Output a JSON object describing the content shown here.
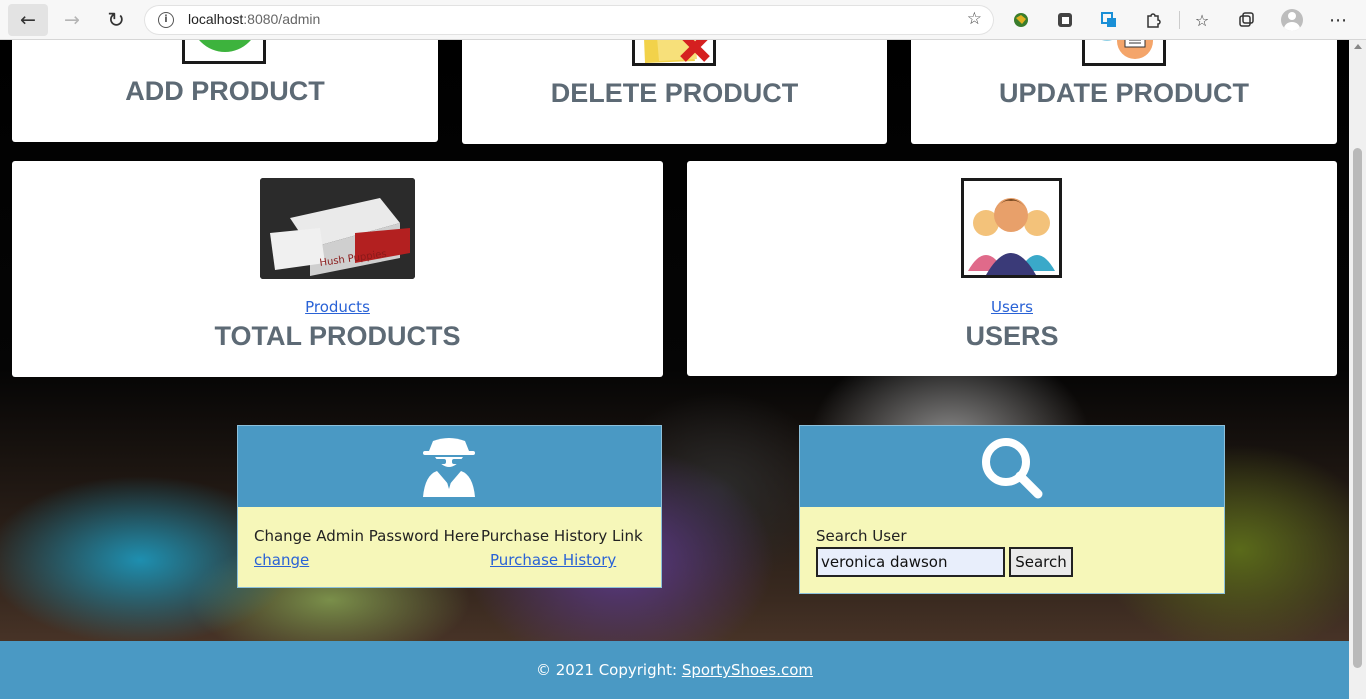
{
  "browser": {
    "url_host": "localhost",
    "url_path": ":8080/admin"
  },
  "cards": {
    "add_product": "ADD PRODUCT",
    "delete_product": "DELETE PRODUCT",
    "update_product": "UPDATE PRODUCT",
    "total_products": {
      "link": "Products",
      "title": "TOTAL PRODUCTS"
    },
    "users": {
      "link": "Users",
      "title": "USERS"
    }
  },
  "admin_panel": {
    "change_label": "Change Admin Password Here",
    "change_link": "change",
    "history_label": "Purchase History Link",
    "history_link": "Purchase History"
  },
  "search_panel": {
    "label": "Search User",
    "input_value": "veronica dawson",
    "button": "Search"
  },
  "footer": {
    "text": "© 2021 Copyright: ",
    "link": "SportyShoes.com"
  },
  "colors": {
    "panel_header": "#4a99c4",
    "panel_body": "#f6f7b9",
    "footer": "#4a99c4",
    "card_title": "#5d6a75",
    "link": "#2962d6"
  }
}
